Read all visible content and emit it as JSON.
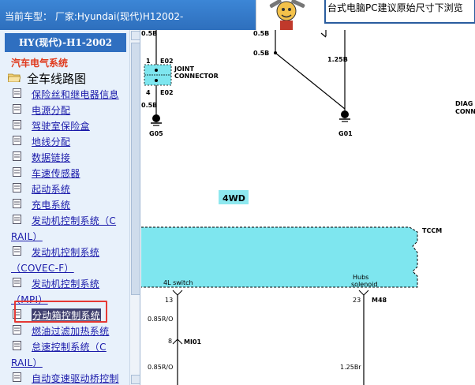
{
  "header": {
    "title": "当前车型：  厂家:Hyundai(现代)H12002-",
    "notice": "台式电脑PC建议原始尺寸下浏览"
  },
  "sidebar": {
    "model": "HY(现代)-H1-2002",
    "section": "汽车电气系统",
    "root": "全车线路图",
    "items": [
      {
        "label": "保险丝和继电器信息"
      },
      {
        "label": "电源分配"
      },
      {
        "label": "驾驶室保险盒"
      },
      {
        "label": "地线分配"
      },
      {
        "label": "数据链接"
      },
      {
        "label": "车速传感器"
      },
      {
        "label": "起动系统"
      },
      {
        "label": "充电系统"
      },
      {
        "label": "发动机控制系统（C",
        "cont": "RAIL）"
      },
      {
        "label": "发动机控制系统",
        "cont": "（COVEC-F）"
      },
      {
        "label": "发动机控制系统",
        "cont": "（MPI）"
      },
      {
        "label": "分动箱控制系统",
        "selected": true
      },
      {
        "label": "燃油过滤加热系统"
      },
      {
        "label": "怠速控制系统（C",
        "cont": "RAIL）"
      },
      {
        "label": "自动变速驱动桥控制"
      }
    ]
  },
  "diagram": {
    "labels": {
      "w05b_left_top": "0.5B",
      "e02_pin1": "1",
      "e02_top": "E02",
      "joint1": "JOINT",
      "joint2": "CONNECTOR",
      "e02_pin4": "4",
      "e02_bottom": "E02",
      "w05b_left_bottom": "0.5B",
      "g05": "G05",
      "w05b_mid_top": "0.5B",
      "w05b_mid": "0.5B",
      "w125b_top": "1.25B",
      "g01": "G01",
      "diag1": "DIAG",
      "diag2": "CONN",
      "fwd": "4WD",
      "tccm": "TCCM",
      "switch_4l": "4L switch",
      "hubs1": "Hubs",
      "hubs2": "solenoid",
      "pin13": "13",
      "pin23": "23",
      "m48": "M48",
      "w085ro_1": "0.85R/O",
      "pin8": "8",
      "mi01": "MI01",
      "w085ro_2": "0.85R/O",
      "w125br": "1.25Br"
    }
  }
}
